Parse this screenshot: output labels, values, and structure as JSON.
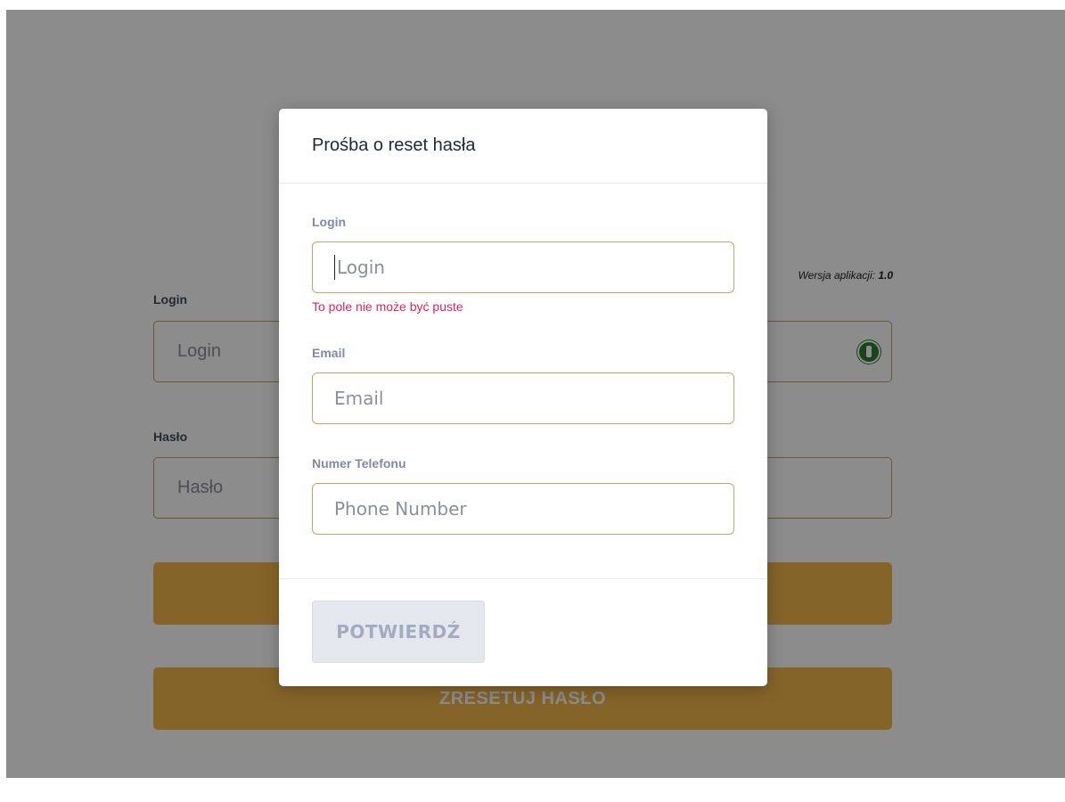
{
  "background": {
    "title": "",
    "version_label": "Wersja aplikacji:",
    "version_value": "1.0",
    "login_label": "Login",
    "login_placeholder": "Login",
    "password_label": "Hasło",
    "password_placeholder": "Hasło",
    "login_button": "",
    "reset_button": "ZRESETUJ HASŁO"
  },
  "modal": {
    "title": "Prośba o reset hasła",
    "login": {
      "label": "Login",
      "placeholder": "Login",
      "error": "To pole nie może być puste"
    },
    "email": {
      "label": "Email",
      "placeholder": "Email"
    },
    "phone": {
      "label": "Numer Telefonu",
      "placeholder": "Phone Number"
    },
    "confirm_button": "POTWIERDŹ"
  },
  "colors": {
    "accent": "#c9a365",
    "button_brown": "#7a5c2f",
    "error": "#e0245e",
    "disabled_button": "#e4e7ee"
  },
  "icons": [
    "key-icon"
  ]
}
